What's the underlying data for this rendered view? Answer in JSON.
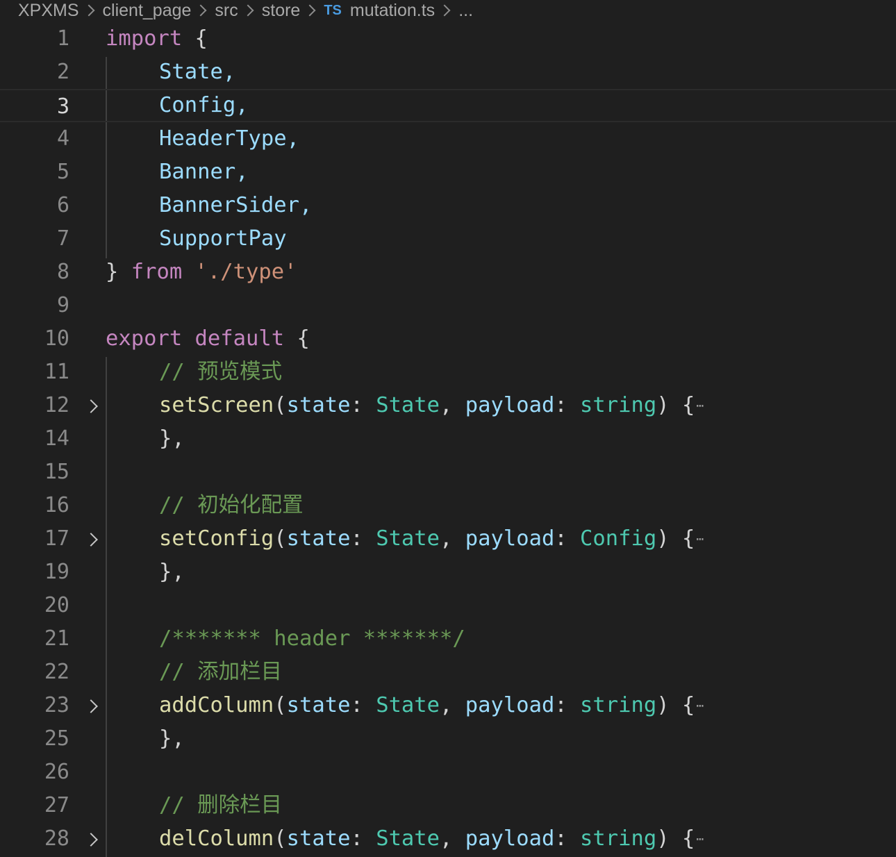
{
  "breadcrumb": {
    "items": [
      "XPXMS",
      "client_page",
      "src",
      "store"
    ],
    "file_badge": "TS",
    "file_name": "mutation.ts",
    "more": "..."
  },
  "editor": {
    "current_line": "3",
    "lines": [
      {
        "n": "1"
      },
      {
        "n": "2"
      },
      {
        "n": "3"
      },
      {
        "n": "4"
      },
      {
        "n": "5"
      },
      {
        "n": "6"
      },
      {
        "n": "7"
      },
      {
        "n": "8"
      },
      {
        "n": "9"
      },
      {
        "n": "10"
      },
      {
        "n": "11"
      },
      {
        "n": "12"
      },
      {
        "n": "14"
      },
      {
        "n": "15"
      },
      {
        "n": "16"
      },
      {
        "n": "17"
      },
      {
        "n": "19"
      },
      {
        "n": "20"
      },
      {
        "n": "21"
      },
      {
        "n": "22"
      },
      {
        "n": "23"
      },
      {
        "n": "25"
      },
      {
        "n": "26"
      },
      {
        "n": "27"
      },
      {
        "n": "28"
      }
    ],
    "tokens": {
      "import": "import",
      "open_brace": " {",
      "state_import": "State,",
      "config_import": "Config,",
      "headertype_import": "HeaderType,",
      "banner_import": "Banner,",
      "bannersider_import": "BannerSider,",
      "supportpay_import": "SupportPay",
      "close_brace": "} ",
      "from": "from",
      "path": " './type'",
      "export": "export",
      "default": " default",
      "export_open": " {",
      "comment_preview": "// 预览模式",
      "setScreen": "setScreen",
      "comment_init": "// 初始化配置",
      "setConfig": "setConfig",
      "comment_header": "/******* header *******/",
      "comment_add": "// 添加栏目",
      "addColumn": "addColumn",
      "comment_del": "// 删除栏目",
      "delColumn": "delColumn",
      "paren_open": "(",
      "state": "state",
      "colon": ": ",
      "State": "State",
      "comma": ", ",
      "payload": "payload",
      "string": "string",
      "Config": "Config",
      "paren_close": ") {",
      "ellipsis": "⋯",
      "close_fn": "},"
    }
  }
}
